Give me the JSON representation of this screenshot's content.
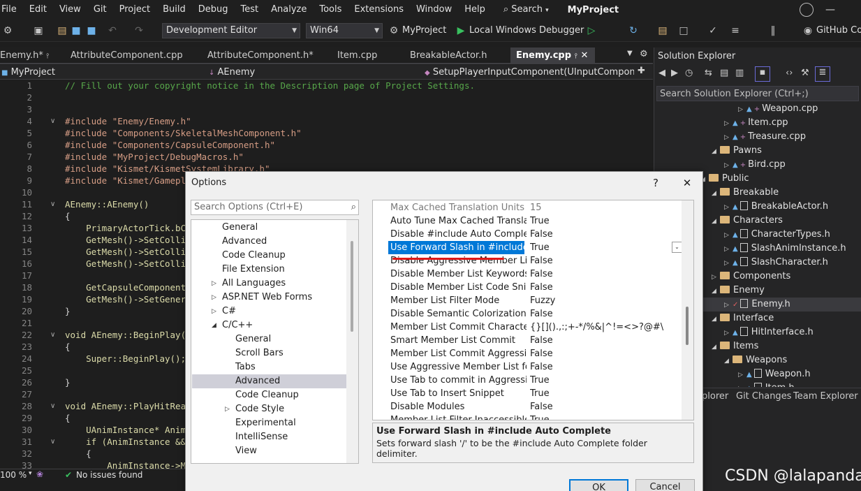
{
  "menu": {
    "items": [
      "File",
      "Edit",
      "View",
      "Git",
      "Project",
      "Build",
      "Debug",
      "Test",
      "Analyze",
      "Tools",
      "Extensions",
      "Window",
      "Help"
    ],
    "search_label": "Search",
    "app_title": "MyProject"
  },
  "toolbar": {
    "config": "Development Editor",
    "platform": "Win64",
    "startup_project": "MyProject",
    "debugger": "Local Windows Debugger",
    "github": "GitHub Cop"
  },
  "tabs": [
    {
      "label": "Enemy.h*",
      "pin": "↕"
    },
    {
      "label": "AttributeComponent.cpp"
    },
    {
      "label": "AttributeComponent.h*"
    },
    {
      "label": "Item.cpp"
    },
    {
      "label": "BreakableActor.h"
    },
    {
      "label": "Enemy.cpp",
      "active": true
    }
  ],
  "nav": {
    "project": "MyProject",
    "class": "AEnemy",
    "member": "SetupPlayerInputComponent(UInputComponen"
  },
  "code": {
    "line_numbers": [
      "1",
      "2",
      "3",
      "4",
      "5",
      "6",
      "7",
      "8",
      "9",
      "10",
      "11",
      "12",
      "13",
      "14",
      "15",
      "16",
      "17",
      "18",
      "19",
      "20",
      "21",
      "22",
      "23",
      "24",
      "25",
      "26",
      "27",
      "28",
      "29",
      "30",
      "31",
      "32",
      "33"
    ],
    "lines": [
      "// Fill out your copyright notice in the Description page of Project Settings.",
      "",
      "",
      "#include \"Enemy/Enemy.h\"",
      "#include \"Components/SkeletalMeshComponent.h\"",
      "#include \"Components/CapsuleComponent.h\"",
      "#include \"MyProject/DebugMacros.h\"",
      "#include \"Kismet/KismetSystemLibrary.h\"",
      "#include \"Kismet/Gamepl",
      "",
      "AEnemy::AEnemy()",
      "{",
      "    PrimaryActorTick.bC",
      "    GetMesh()->SetColli",
      "    GetMesh()->SetColli",
      "    GetMesh()->SetColli",
      "",
      "    GetCapsuleComponent",
      "    GetMesh()->SetGener",
      "}",
      "",
      "void AEnemy::BeginPlay(",
      "{",
      "    Super::BeginPlay();",
      "",
      "}",
      "",
      "void AEnemy::PlayHitRea",
      "{",
      "    UAnimInstance* Anim",
      "    if (AnimInstance &&",
      "    {",
      "        AnimInstance->M"
    ]
  },
  "status": {
    "zoom": "100 %",
    "issues": "No issues found"
  },
  "solution_explorer": {
    "title": "Solution Explorer",
    "search_placeholder": "Search Solution Explorer (Ctrl+;)",
    "items": [
      {
        "label": "Weapon.cpp",
        "kind": "cpp"
      },
      {
        "label": "Item.cpp",
        "kind": "cpp"
      },
      {
        "label": "Treasure.cpp",
        "kind": "cpp"
      },
      {
        "label": "Pawns",
        "kind": "folder"
      },
      {
        "label": "Bird.cpp",
        "kind": "cpp"
      },
      {
        "label": "Public",
        "kind": "folder"
      },
      {
        "label": "Breakable",
        "kind": "folder"
      },
      {
        "label": "BreakableActor.h",
        "kind": "h"
      },
      {
        "label": "Characters",
        "kind": "folder"
      },
      {
        "label": "CharacterTypes.h",
        "kind": "h"
      },
      {
        "label": "SlashAnimInstance.h",
        "kind": "h"
      },
      {
        "label": "SlashCharacter.h",
        "kind": "h"
      },
      {
        "label": "Components",
        "kind": "folder"
      },
      {
        "label": "Enemy",
        "kind": "folder"
      },
      {
        "label": "Enemy.h",
        "kind": "h"
      },
      {
        "label": "Interface",
        "kind": "folder"
      },
      {
        "label": "HitInterface.h",
        "kind": "h"
      },
      {
        "label": "Items",
        "kind": "folder"
      },
      {
        "label": "Weapons",
        "kind": "folder"
      },
      {
        "label": "Weapon.h",
        "kind": "h"
      },
      {
        "label": "Item.h",
        "kind": "h"
      }
    ],
    "bottom_tabs": [
      "plorer",
      "Git Changes",
      "Team Explorer"
    ]
  },
  "dialog": {
    "title": "Options",
    "help": "?",
    "close": "✕",
    "search_placeholder": "Search Options (Ctrl+E)",
    "tree": [
      {
        "label": "General",
        "level": 1
      },
      {
        "label": "Advanced",
        "level": 1
      },
      {
        "label": "Code Cleanup",
        "level": 1
      },
      {
        "label": "File Extension",
        "level": 1
      },
      {
        "label": "All Languages",
        "level": 1,
        "expander": "collapsed"
      },
      {
        "label": "ASP.NET Web Forms",
        "level": 1,
        "expander": "collapsed"
      },
      {
        "label": "C#",
        "level": 1,
        "expander": "collapsed"
      },
      {
        "label": "C/C++",
        "level": 1,
        "expander": "expanded"
      },
      {
        "label": "General",
        "level": 2
      },
      {
        "label": "Scroll Bars",
        "level": 2
      },
      {
        "label": "Tabs",
        "level": 2
      },
      {
        "label": "Advanced",
        "level": 2,
        "selected": true
      },
      {
        "label": "Code Cleanup",
        "level": 2
      },
      {
        "label": "Code Style",
        "level": 2,
        "expander": "collapsed"
      },
      {
        "label": "Experimental",
        "level": 2
      },
      {
        "label": "IntelliSense",
        "level": 2
      },
      {
        "label": "View",
        "level": 2
      }
    ],
    "grid": [
      {
        "name": "Max Cached Translation Units",
        "value": "15",
        "dim": true
      },
      {
        "name": "Auto Tune Max Cached Translation Units",
        "value": "True"
      },
      {
        "name": "Disable #include Auto Complete",
        "value": "False"
      },
      {
        "name": "Use Forward Slash in #include Auto Complete",
        "value": "True",
        "selected": true
      },
      {
        "name": "Disable Aggressive Member List",
        "value": "False"
      },
      {
        "name": "Disable Member List Keywords",
        "value": "False"
      },
      {
        "name": "Disable Member List Code Snippets",
        "value": "False"
      },
      {
        "name": "Member List Filter Mode",
        "value": "Fuzzy"
      },
      {
        "name": "Disable Semantic Colorization",
        "value": "False"
      },
      {
        "name": "Member List Commit Characters",
        "value": "{}[]().,:;+-*/%&|^!=<>?@#\\"
      },
      {
        "name": "Smart Member List Commit",
        "value": "False"
      },
      {
        "name": "Member List Commit Aggressive",
        "value": "False"
      },
      {
        "name": "Use Aggressive Member List for Auto Complete",
        "value": "False"
      },
      {
        "name": "Use Tab to commit in Aggressive Member List",
        "value": "True"
      },
      {
        "name": "Use Tab to Insert Snippet",
        "value": "True"
      },
      {
        "name": "Disable Modules",
        "value": "False"
      },
      {
        "name": "Member List Filter Inaccessible",
        "value": "True"
      }
    ],
    "description_title": "Use Forward Slash in #include Auto Complete",
    "description_text": "Sets forward slash '/' to be the #include Auto Complete folder delimiter.",
    "ok": "OK",
    "cancel": "Cancel"
  },
  "watermark": "CSDN @lalapanda"
}
